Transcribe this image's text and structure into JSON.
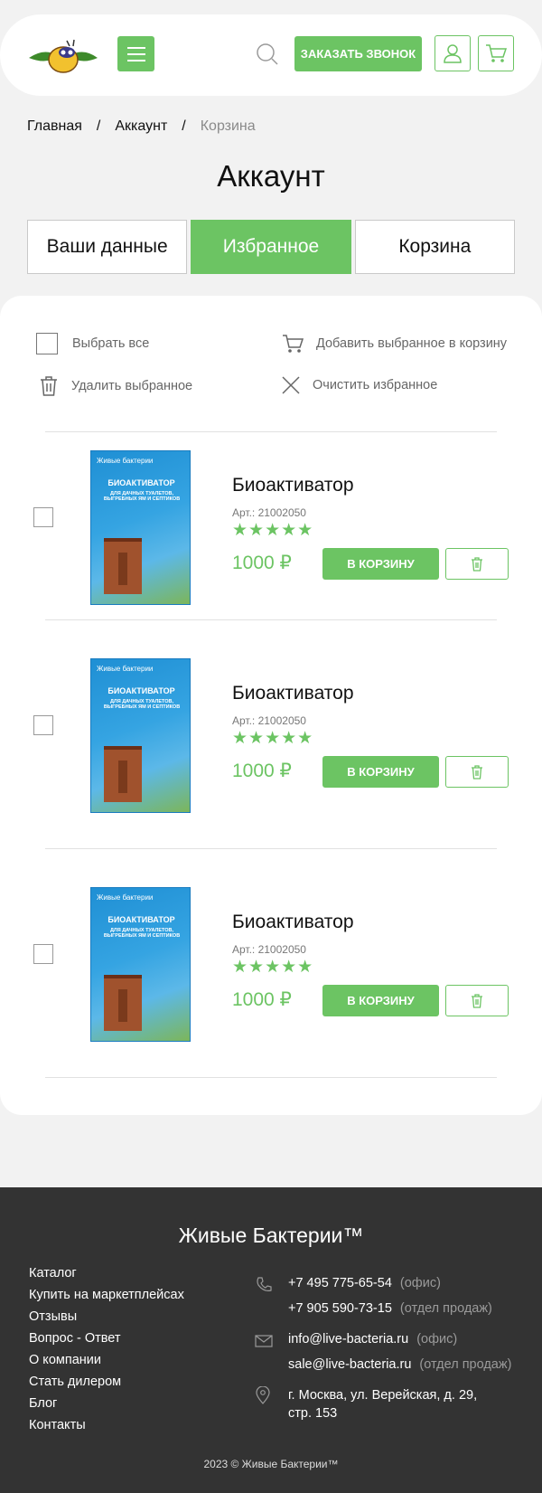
{
  "header": {
    "call_label": "ЗАКАЗАТЬ ЗВОНОК",
    "icons": [
      "logo-bee",
      "menu-icon",
      "search-icon",
      "user-icon",
      "cart-icon"
    ]
  },
  "breadcrumb": {
    "items": [
      "Главная",
      "Аккаунт",
      "Корзина"
    ],
    "separator": "/"
  },
  "page": {
    "title": "Аккаунт"
  },
  "tabs": [
    {
      "label": "Ваши данные",
      "active": false
    },
    {
      "label": "Избранное",
      "active": true
    },
    {
      "label": "Корзина",
      "active": false
    }
  ],
  "actions": {
    "select_all": "Выбрать все",
    "add_selected": "Добавить выбранное в корзину",
    "delete_selected": "Удалить выбранное",
    "clear_favorites": "Очистить избранное"
  },
  "products": [
    {
      "name": "Биоактиватор",
      "article": "Арт.: 21002050",
      "rating": 5,
      "stars": "★★★★★",
      "price": "1000 ₽",
      "cart_label": "В КОРЗИНУ",
      "package": {
        "brand": "Живые бактерии",
        "title": "БИОАКТИВАТОР",
        "subtitle": "ДЛЯ ДАЧНЫХ ТУАЛЕТОВ, ВЫГРЕБНЫХ ЯМ И СЕПТИКОВ"
      }
    },
    {
      "name": "Биоактиватор",
      "article": "Арт.: 21002050",
      "rating": 5,
      "stars": "★★★★★",
      "price": "1000 ₽",
      "cart_label": "В КОРЗИНУ",
      "package": {
        "brand": "Живые бактерии",
        "title": "БИОАКТИВАТОР",
        "subtitle": "ДЛЯ ДАЧНЫХ ТУАЛЕТОВ, ВЫГРЕБНЫХ ЯМ И СЕПТИКОВ"
      }
    },
    {
      "name": "Биоактиватор",
      "article": "Арт.: 21002050",
      "rating": 5,
      "stars": "★★★★★",
      "price": "1000 ₽",
      "cart_label": "В КОРЗИНУ",
      "package": {
        "brand": "Живые бактерии",
        "title": "БИОАКТИВАТОР",
        "subtitle": "ДЛЯ ДАЧНЫХ ТУАЛЕТОВ, ВЫГРЕБНЫХ ЯМ И СЕПТИКОВ"
      }
    }
  ],
  "footer": {
    "brand": "Живые Бактерии™",
    "links": [
      "Каталог",
      "Купить на маркетплейсах",
      "Отзывы",
      "Вопрос - Ответ",
      "О компании",
      "Стать дилером",
      "Блог",
      "Контакты"
    ],
    "phones": [
      {
        "value": "+7 495 775-65-54",
        "note": "(офис)"
      },
      {
        "value": "+7 905 590-73-15",
        "note": "(отдел продаж)"
      }
    ],
    "emails": [
      {
        "value": "info@live-bacteria.ru",
        "note": "(офис)"
      },
      {
        "value": "sale@live-bacteria.ru",
        "note": "(отдел продаж)"
      }
    ],
    "address_line1": "г. Москва, ул. Верейская, д. 29,",
    "address_line2": "стр. 153",
    "copyright": "2023 © Живые Бактерии™"
  },
  "colors": {
    "accent": "#6cc463",
    "footer_bg": "#333333",
    "page_bg": "#f2f2f2"
  }
}
